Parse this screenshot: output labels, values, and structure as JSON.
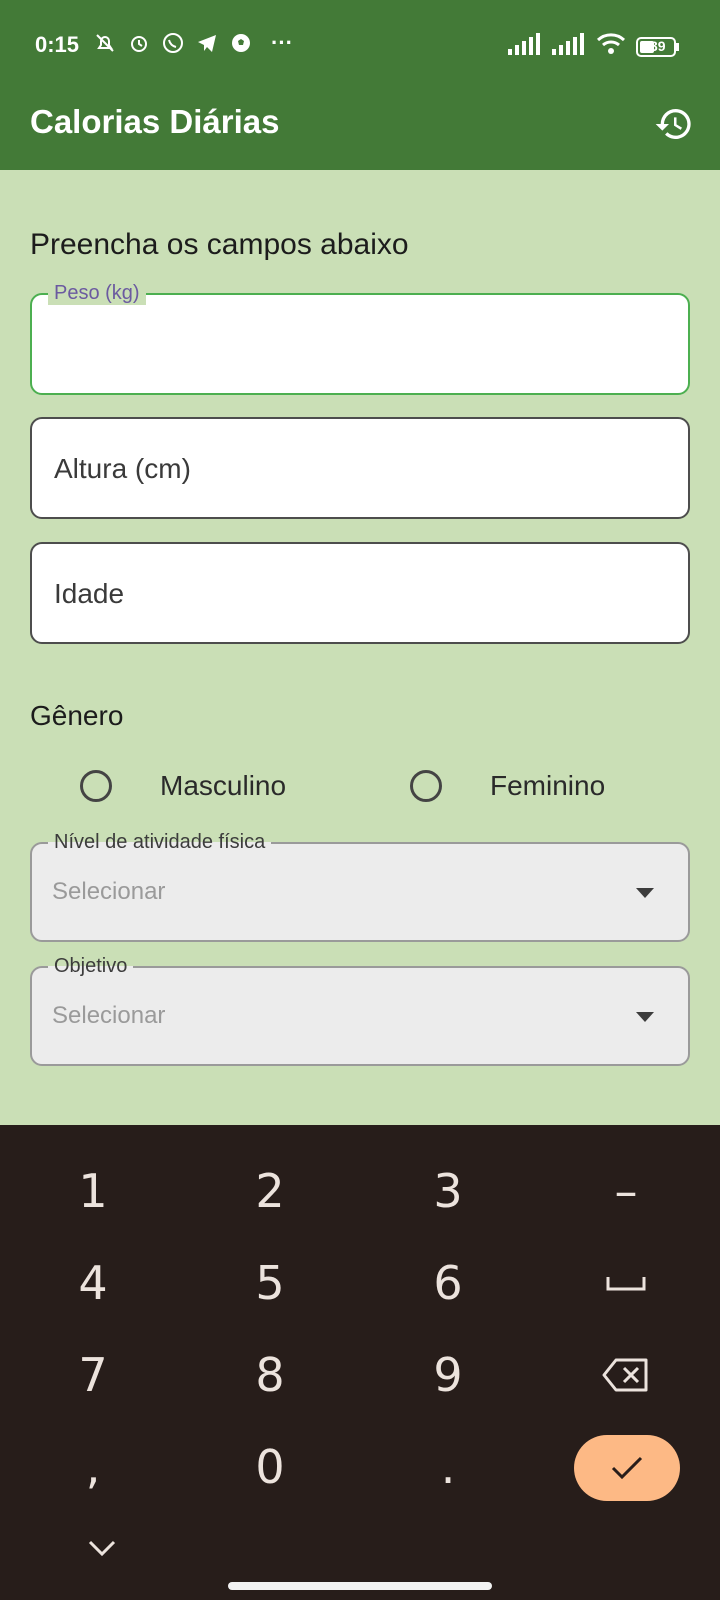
{
  "status_bar": {
    "time": "0:15",
    "battery": "39",
    "more": "···"
  },
  "app_bar": {
    "title": "Calorias Diárias"
  },
  "form": {
    "subtitle": "Preencha os campos abaixo",
    "peso_label": "Peso (kg)",
    "altura_placeholder": "Altura (cm)",
    "idade_placeholder": "Idade",
    "genero_label": "Gênero",
    "genero_options": [
      "Masculino",
      "Feminino"
    ],
    "atividade_label": "Nível de atividade física",
    "atividade_value": "Selecionar",
    "objetivo_label": "Objetivo",
    "objetivo_value": "Selecionar"
  },
  "keyboard": {
    "keys": [
      "1",
      "2",
      "3",
      "–",
      "4",
      "5",
      "6",
      "␣",
      "7",
      "8",
      "9",
      "⌫",
      ",",
      "0",
      ".",
      "✓"
    ]
  },
  "colors": {
    "app_bar": "#437a37",
    "background": "#cadfb6",
    "keyboard": "#271d1a",
    "accent_key": "#fdb985"
  }
}
